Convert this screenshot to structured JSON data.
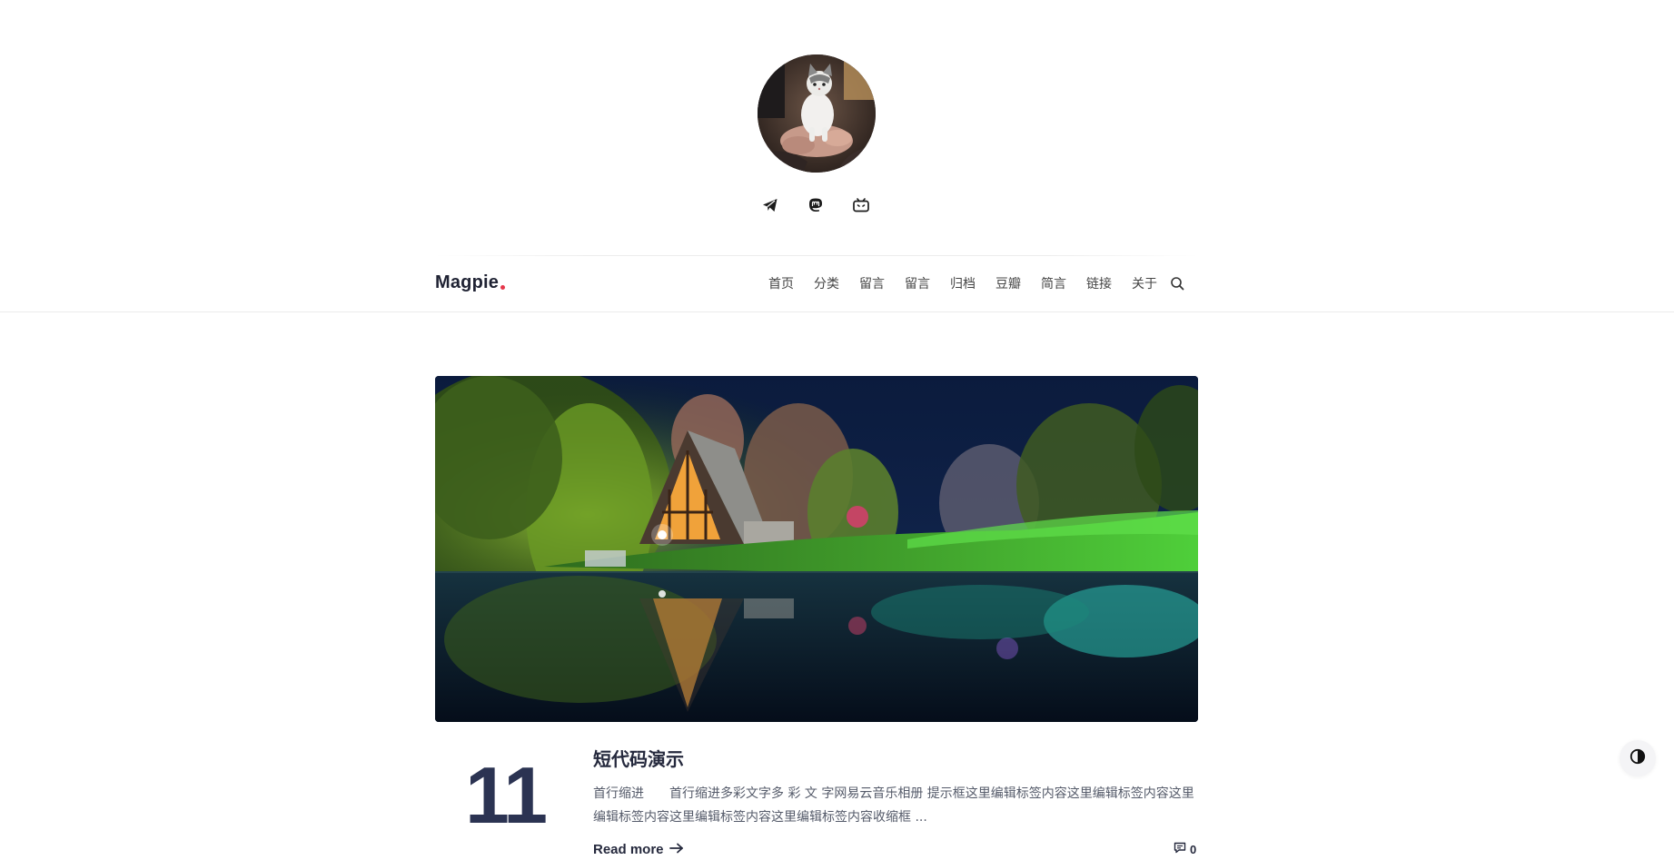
{
  "site": {
    "brand": "Magpie",
    "accent_color": "#e5364a"
  },
  "hero": {
    "avatar_alt": "avatar",
    "social_icons": [
      "telegram-icon",
      "mastodon-icon",
      "bilibili-icon"
    ]
  },
  "nav": {
    "items": [
      "首页",
      "分类",
      "留言",
      "留言",
      "归档",
      "豆瓣",
      "简言",
      "链接",
      "关于"
    ],
    "search_icon": "search-icon"
  },
  "post": {
    "day": "11",
    "title": "短代码演示",
    "excerpt": "首行缩进　　首行缩进多彩文字多 彩 文 字网易云音乐相册 提示框这里编辑标签内容这里编辑标签内容这里编辑标签内容这里编辑标签内容这里编辑标签内容收缩框 ...",
    "read_more": "Read more",
    "comment_count": "0"
  },
  "theme_toggle": {
    "icon": "contrast-icon"
  }
}
